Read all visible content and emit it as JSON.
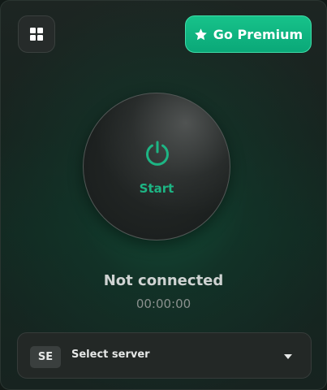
{
  "header": {
    "menu_icon": "grid-icon",
    "premium_icon": "star-icon",
    "premium_label": "Go Premium"
  },
  "connect": {
    "icon": "power-icon",
    "label": "Start"
  },
  "status": {
    "text": "Not connected",
    "timer": "00:00:00"
  },
  "server": {
    "country_code": "SE",
    "label": "Select server",
    "dropdown_icon": "chevron-down-icon"
  },
  "colors": {
    "accent": "#17c28a",
    "power_green": "#1db584"
  }
}
